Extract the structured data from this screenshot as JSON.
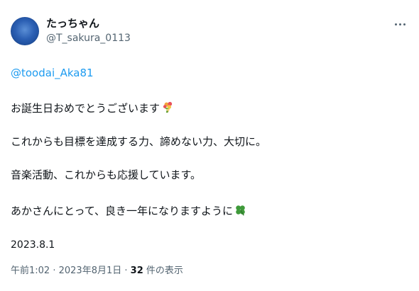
{
  "user": {
    "display_name": "たっちゃん",
    "handle": "@T_sakura_0113"
  },
  "tweet": {
    "mention": "@toodai_Aka81",
    "lines": [
      "お誕生日おめでとうございます",
      "これからも目標を達成する力、諦めない力、大切に。",
      "音楽活動、これからも応援しています。",
      "あかさんにとって、良き一年になりますように"
    ],
    "date_text": "2023.8.1"
  },
  "meta": {
    "time": "午前1:02",
    "separator1": " · ",
    "date": "2023年8月1日",
    "separator2": " · ",
    "views_count": "32",
    "views_label": " 件の表示"
  },
  "icons": {
    "more": "more-options-icon",
    "bouquet": "bouquet-emoji",
    "clover": "four-leaf-clover-emoji"
  },
  "colors": {
    "link": "#1d9bf0",
    "secondary_text": "#536471",
    "primary_text": "#0f1419"
  }
}
